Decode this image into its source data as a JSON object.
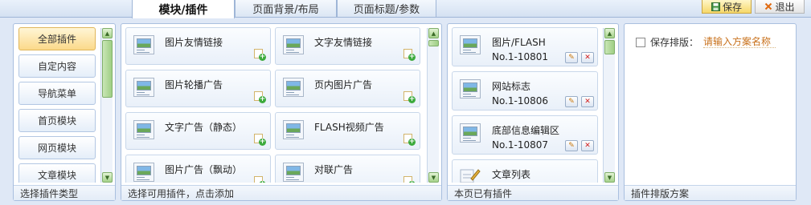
{
  "tabs": [
    {
      "label": "模块/插件",
      "active": true
    },
    {
      "label": "页面背景/布局",
      "active": false
    },
    {
      "label": "页面标题/参数",
      "active": false
    }
  ],
  "toolbar": {
    "save_label": "保存",
    "exit_label": "退出"
  },
  "categories": {
    "items": [
      "全部插件",
      "自定内容",
      "导航菜单",
      "首页模块",
      "网页模块",
      "文章模块"
    ],
    "footer": "选择插件类型"
  },
  "available": {
    "items": [
      "图片友情链接",
      "文字友情链接",
      "图片轮播广告",
      "页内图片广告",
      "文字广告（静态）",
      "FLASH视频广告",
      "图片广告（飘动）",
      "对联广告"
    ],
    "footer": "选择可用插件，点击添加"
  },
  "existing": {
    "items": [
      {
        "name": "图片/FLASH",
        "code": "No.1-10801"
      },
      {
        "name": "网站标志",
        "code": "No.1-10806"
      },
      {
        "name": "底部信息编辑区",
        "code": "No.1-10807"
      },
      {
        "name": "文章列表",
        "code": ""
      }
    ],
    "footer": "本页已有插件"
  },
  "scheme": {
    "label": "保存排版：",
    "placeholder": "请输入方案名称",
    "footer": "插件排版方案"
  },
  "colors": {
    "accent": "#3caa3c",
    "active_category": "#fbd98a",
    "panel_border": "#a9bfdf",
    "placeholder": "#c8701a"
  }
}
